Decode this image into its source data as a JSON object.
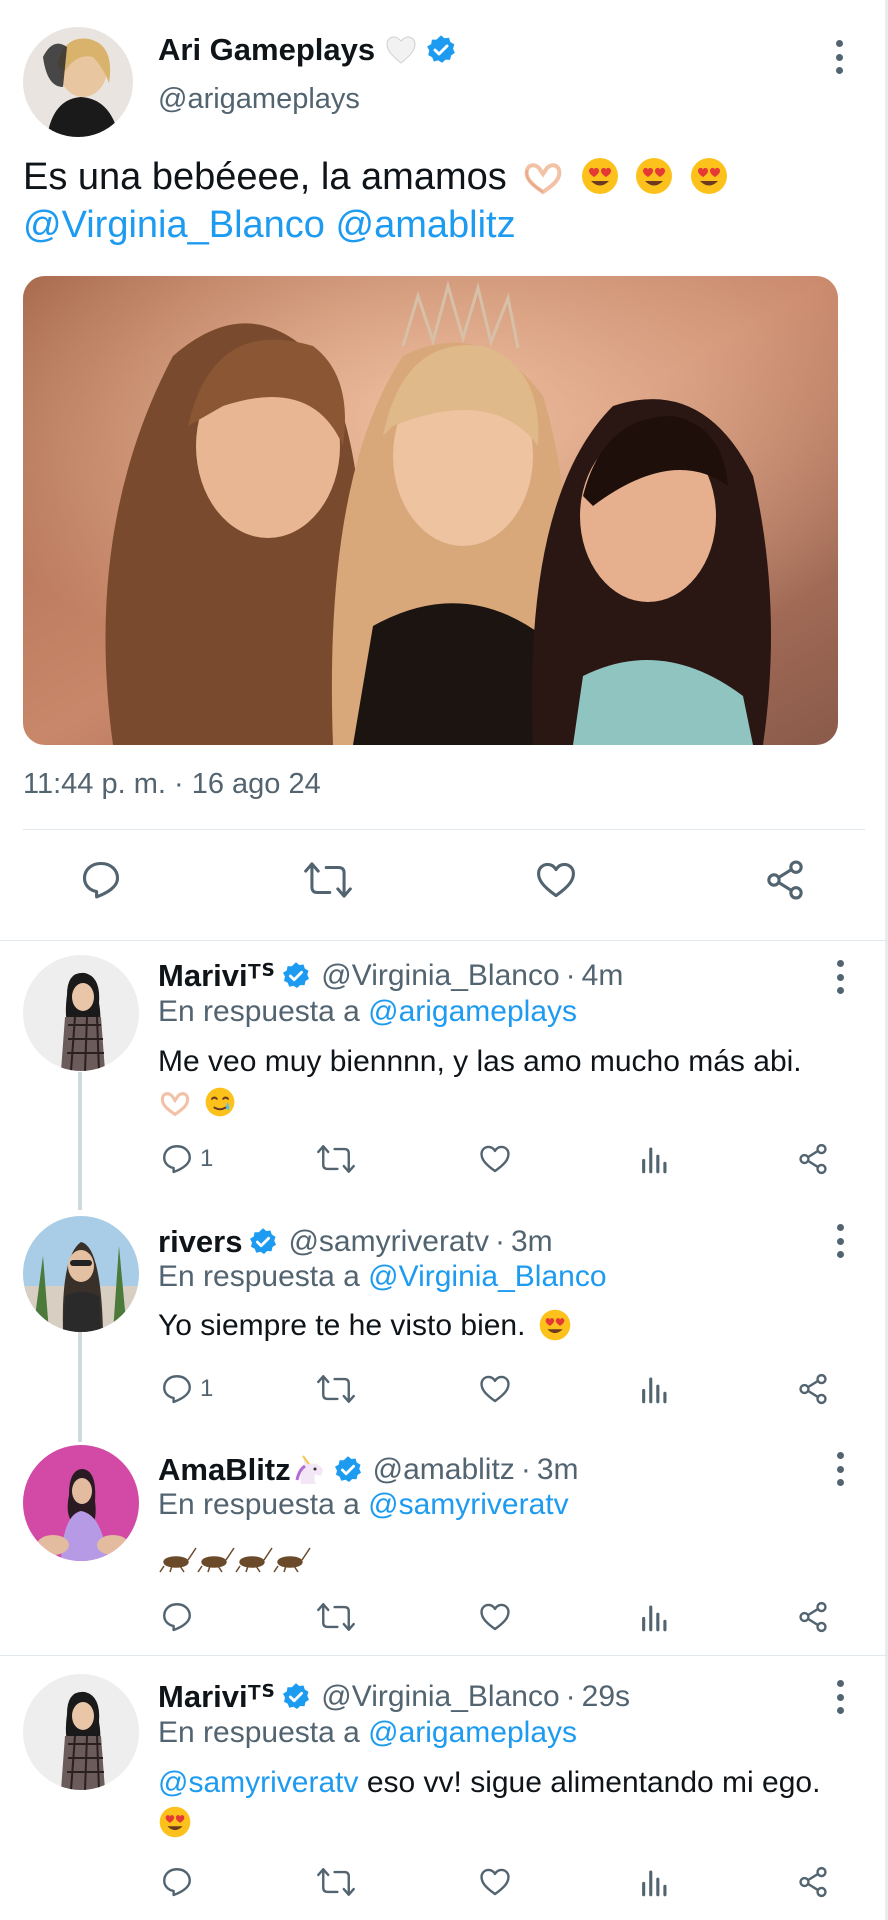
{
  "main_tweet": {
    "author_name": "Ari Gameplays",
    "author_handle": "@arigameplays",
    "text": "Es una bebéeee, la amamos",
    "mention_1": "@Virginia_Blanco",
    "mention_2": "@amablitz",
    "timestamp": "11:44 p. m. · 16 ago 24",
    "actions": [
      "reply-icon",
      "retweet-icon",
      "like-icon",
      "share-icon"
    ]
  },
  "replies": [
    {
      "author_name": "Mariviᵀᔆ",
      "author_handle": "@Virginia_Blanco",
      "separator": "·",
      "time": "4m",
      "reply_to_prefix": "En respuesta a",
      "reply_to": "@arigameplays",
      "text": "Me veo muy biennnn, y las amo mucho más abi.",
      "reply_count": "1"
    },
    {
      "author_name": "rivers",
      "author_handle": "@samyriveratv",
      "separator": "·",
      "time": "3m",
      "reply_to_prefix": "En respuesta a",
      "reply_to": "@Virginia_Blanco",
      "text": "Yo siempre te he visto bien.",
      "reply_count": "1"
    },
    {
      "author_name": "AmaBlitz",
      "author_handle": "@amablitz",
      "separator": "·",
      "time": "3m",
      "reply_to_prefix": "En respuesta a",
      "reply_to": "@samyriveratv",
      "text": "",
      "reply_count": ""
    },
    {
      "author_name": "Mariviᵀᔆ",
      "author_handle": "@Virginia_Blanco",
      "separator": "·",
      "time": "29s",
      "reply_to_prefix": "En respuesta a",
      "reply_to": "@arigameplays",
      "text_mention": "@samyriveratv",
      "text": "eso vv! sigue alimentando mi ego.",
      "reply_count": ""
    }
  ],
  "colors": {
    "accent": "#1d9bf0",
    "text": "#0f1419",
    "secondary": "#536471",
    "divider": "#e1e8ed"
  }
}
